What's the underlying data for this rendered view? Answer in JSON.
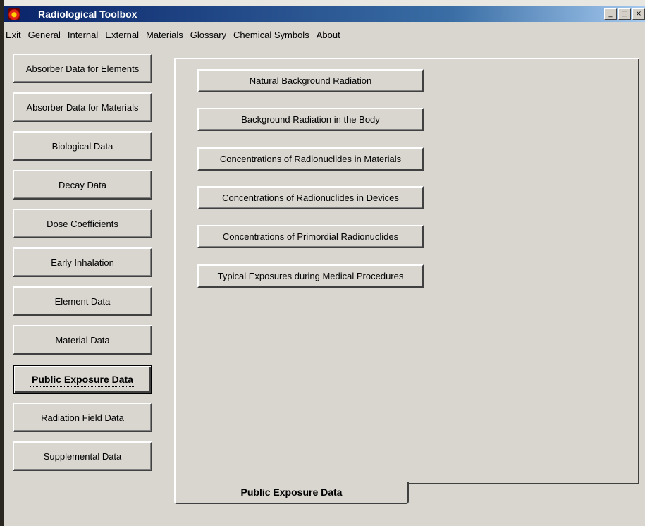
{
  "window": {
    "title": "Radiological Toolbox",
    "controls": {
      "minimize": "_",
      "maximize": "□",
      "close": "×"
    }
  },
  "menu": [
    "Exit",
    "General",
    "Internal",
    "External",
    "Materials",
    "Glossary",
    "Chemical Symbols",
    "About"
  ],
  "sidebar": {
    "items": [
      {
        "label": "Absorber Data for Elements"
      },
      {
        "label": "Absorber Data for Materials"
      },
      {
        "label": "Biological Data"
      },
      {
        "label": "Decay Data"
      },
      {
        "label": "Dose Coefficients"
      },
      {
        "label": "Early Inhalation"
      },
      {
        "label": "Element Data"
      },
      {
        "label": "Material Data"
      },
      {
        "label": "Public Exposure Data"
      },
      {
        "label": "Radiation Field Data"
      },
      {
        "label": "Supplemental Data"
      }
    ],
    "active": "Public Exposure Data"
  },
  "panel": {
    "buttons": [
      {
        "label": "Natural Background Radiation"
      },
      {
        "label": "Background Radiation in the Body"
      },
      {
        "label": "Concentrations of Radionuclides in Materials"
      },
      {
        "label": "Concentrations of Radionuclides in Devices"
      },
      {
        "label": "Concentrations of Primordial Radionuclides"
      },
      {
        "label": "Typical Exposures during Medical Procedures"
      }
    ],
    "tab_label": "Public Exposure Data"
  }
}
